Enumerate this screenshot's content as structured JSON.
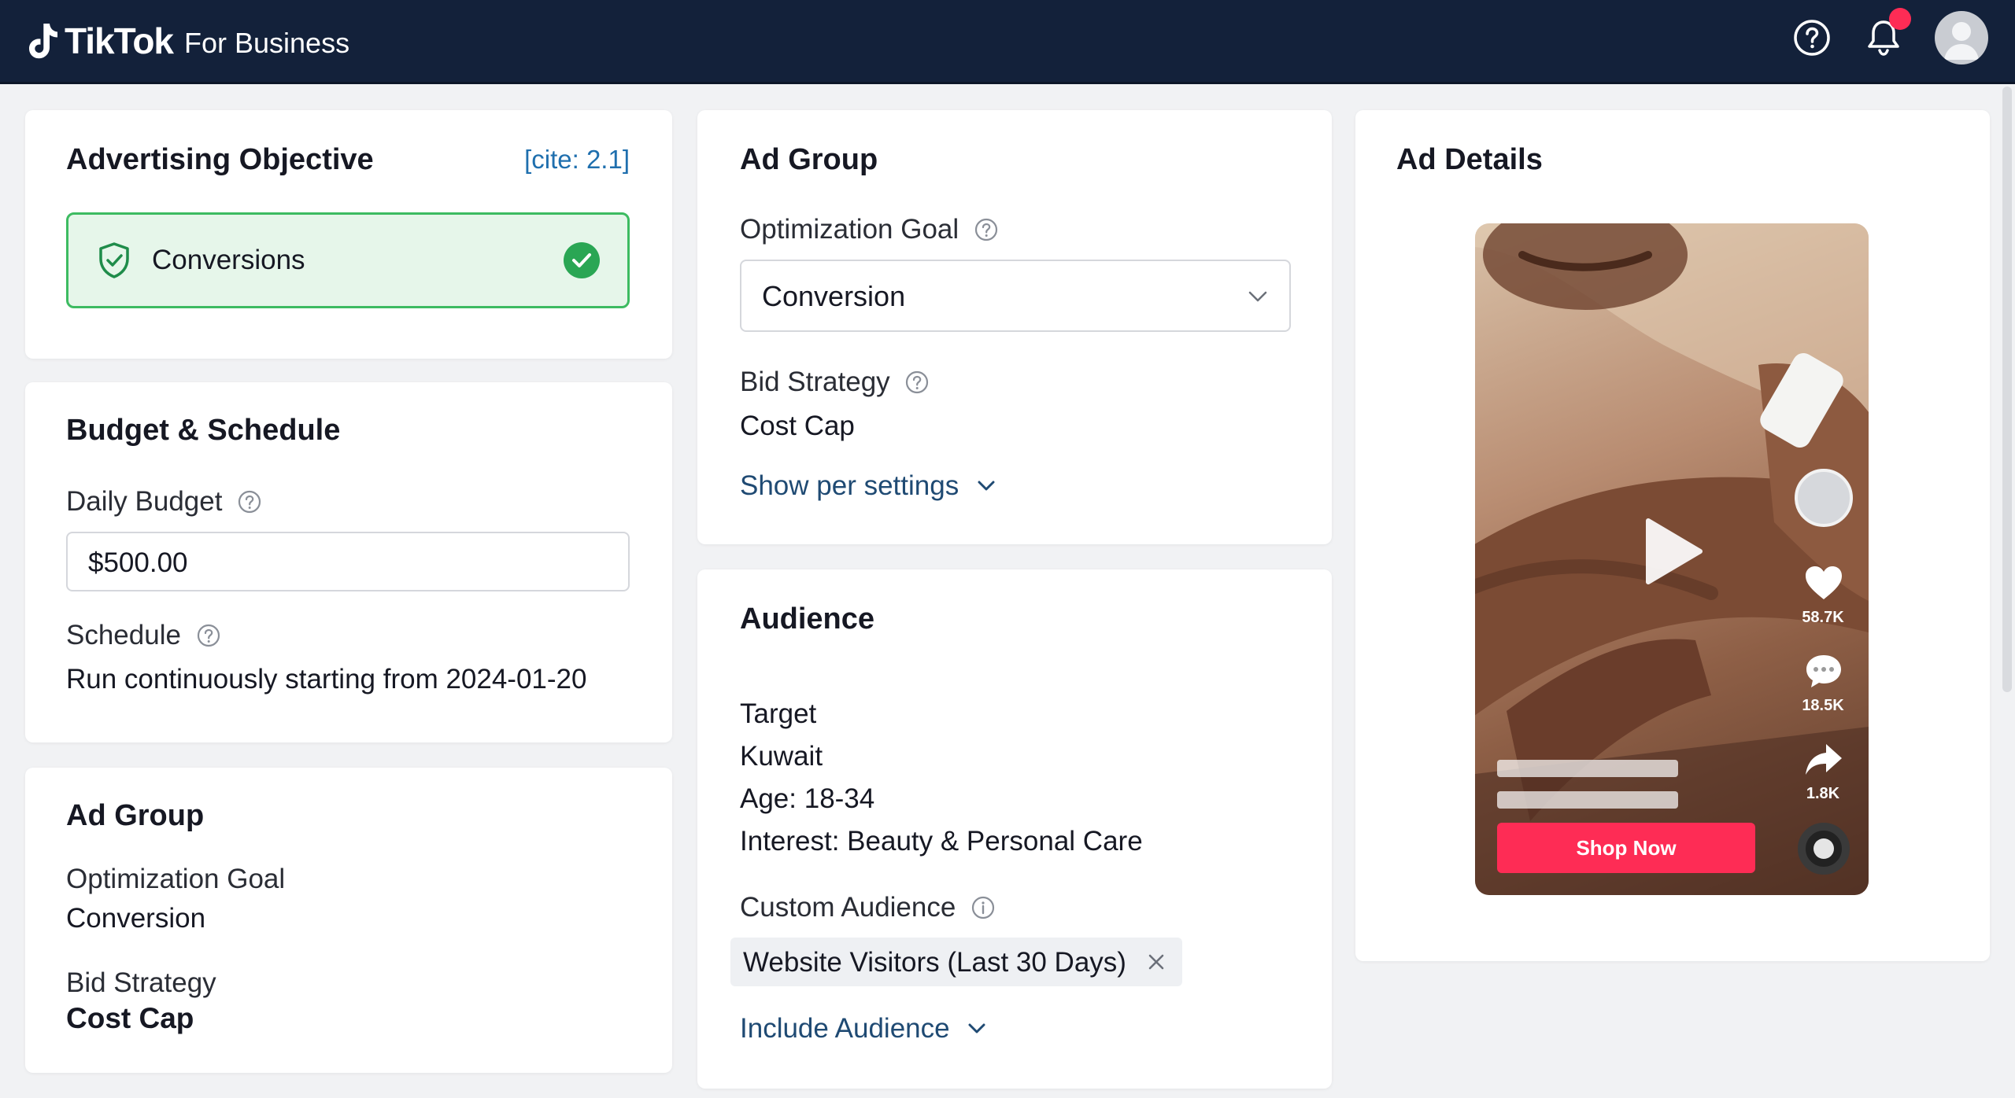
{
  "header": {
    "brand": "TikTok",
    "brand_sub": "For Business",
    "icons": [
      "help-icon",
      "bell-icon",
      "avatar"
    ],
    "colors": {
      "bar": "#13213a",
      "notification": "#fe2c55"
    }
  },
  "advertising_objective": {
    "title": "Advertising Objective",
    "cite": "[cite: 2.1]",
    "selected": "Conversions"
  },
  "budget_schedule": {
    "title": "Budget & Schedule",
    "daily_budget_label": "Daily Budget",
    "daily_budget_value": "$500.00",
    "schedule_label": "Schedule",
    "schedule_value": "Run continuously starting from 2024-01-20"
  },
  "ad_group_summary": {
    "title": "Ad Group",
    "optimization_goal_label": "Optimization Goal",
    "optimization_goal_value": "Conversion",
    "bid_strategy_label": "Bid Strategy",
    "bid_strategy_value": "Cost Cap"
  },
  "ad_group": {
    "title": "Ad Group",
    "optimization_goal_label": "Optimization Goal",
    "optimization_goal_selected": "Conversion",
    "bid_strategy_label": "Bid Strategy",
    "bid_strategy_value": "Cost Cap",
    "show_settings": "Show per settings"
  },
  "audience": {
    "title": "Audience",
    "target_label": "Target",
    "location": "Kuwait",
    "age": "Age: 18-34",
    "interest": "Interest: Beauty & Personal Care",
    "custom_audience_label": "Custom Audience",
    "custom_audience_chip": "Website Visitors (Last 30 Days)",
    "include_audience": "Include Audience"
  },
  "ad_details": {
    "title": "Ad Details",
    "likes": "58.7K",
    "comments": "18.5K",
    "shares": "1.8K",
    "cta": "Shop Now"
  }
}
